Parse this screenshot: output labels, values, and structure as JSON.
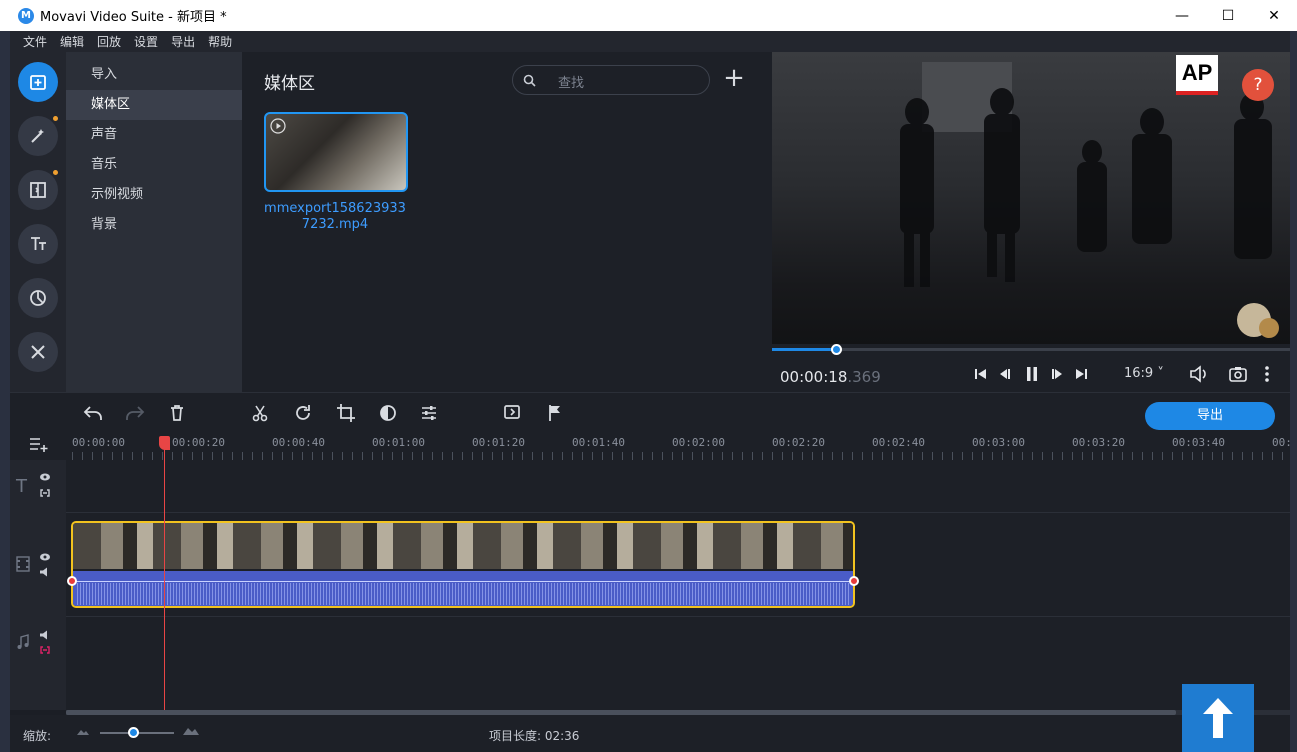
{
  "window": {
    "title": "Movavi Video Suite - 新项目 *",
    "minimize": "—",
    "maximize": "☐",
    "close": "✕"
  },
  "menu": [
    "文件",
    "编辑",
    "回放",
    "设置",
    "导出",
    "帮助"
  ],
  "sidebar": {
    "categories": [
      "导入",
      "媒体区",
      "声音",
      "音乐",
      "示例视频",
      "背景"
    ],
    "active": "媒体区"
  },
  "media": {
    "title": "媒体区",
    "search_placeholder": "查找",
    "add_label": "+",
    "file_name": "mmexport1586239337232.mp4"
  },
  "preview": {
    "logo_text": "AP",
    "help_label": "?",
    "time_main": "00:00:18",
    "time_ms": ".369",
    "aspect": "16:9 ˅",
    "progress": 0.125
  },
  "toolbar": {
    "export_label": "导出"
  },
  "timeline": {
    "ruler_labels": [
      "00:00:00",
      "00:00:20",
      "00:00:40",
      "00:01:00",
      "00:01:20",
      "00:01:40",
      "00:02:00",
      "00:02:20",
      "00:02:40",
      "00:03:00",
      "00:03:20",
      "00:03:40",
      "00:"
    ]
  },
  "status": {
    "zoom_label": "缩放:",
    "project_length": "项目长度: 02:36"
  },
  "colors": {
    "accent": "#1e88e5",
    "clip_border": "#f2c31f",
    "audio": "#4a5cc7",
    "playhead": "#e84545"
  }
}
